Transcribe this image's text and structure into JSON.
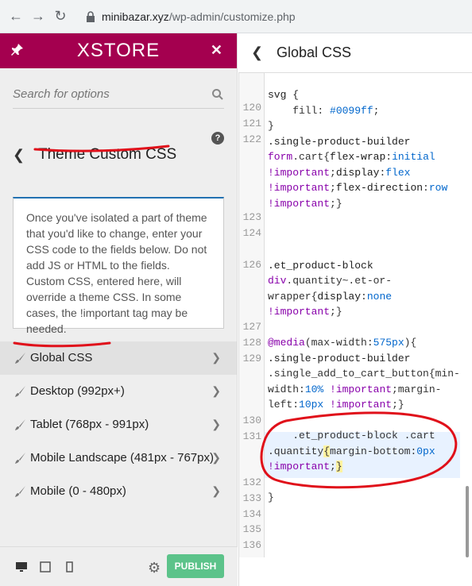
{
  "browser": {
    "url_host": "minibazar.xyz",
    "url_path": "/wp-admin/customize.php"
  },
  "sidebar": {
    "brand": "XSTORE",
    "search_placeholder": "Search for options",
    "section_title": "Theme Custom CSS",
    "description": "Once you've isolated a part of theme that you'd like to change, enter your CSS code to the fields below. Do not add JS or HTML to the fields. Custom CSS, entered here, will override a theme CSS. In some cases, the !important tag may be needed.",
    "items": [
      {
        "label": "Global CSS"
      },
      {
        "label": "Desktop (992px+)"
      },
      {
        "label": "Tablet (768px - 991px)"
      },
      {
        "label": "Mobile Landscape (481px - 767px)"
      },
      {
        "label": "Mobile (0 - 480px)"
      }
    ],
    "publish_label": "PUBLISH"
  },
  "panel": {
    "title": "Global CSS"
  },
  "code": {
    "line_numbers": [
      "120",
      "121",
      "122",
      "123",
      "124",
      "126",
      "127",
      "128",
      "129",
      "130",
      "131",
      "132",
      "133",
      "134",
      "135",
      "136"
    ]
  },
  "colors": {
    "brand": "#a4004f",
    "publish": "#5cc38a",
    "annotation": "#e0101a"
  }
}
